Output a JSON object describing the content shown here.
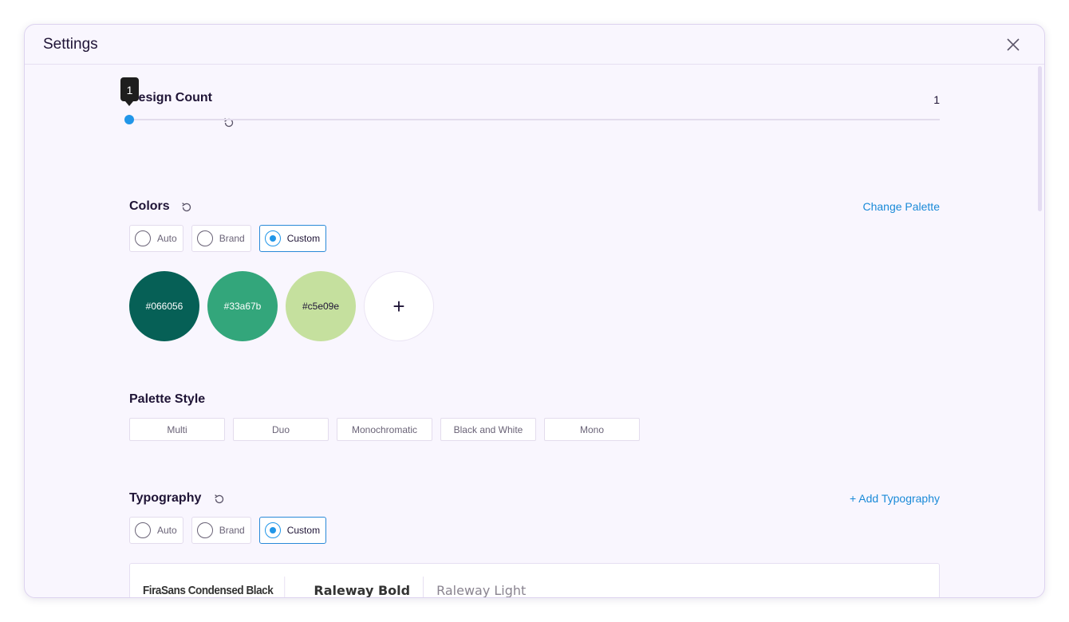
{
  "dialog": {
    "title": "Settings"
  },
  "design_count": {
    "label": "Design Count",
    "value": "1",
    "tooltip": "1",
    "level": 1
  },
  "colors": {
    "label": "Colors",
    "change_palette": "Change Palette",
    "options": [
      "Auto",
      "Brand",
      "Custom"
    ],
    "selected": "Custom",
    "swatches": [
      {
        "hex": "#066056",
        "text_color": "#ffffff"
      },
      {
        "hex": "#33a67b",
        "text_color": "#ffffff"
      },
      {
        "hex": "#c5e09e",
        "text_color": "#1f1436"
      }
    ],
    "add_label": "+"
  },
  "palette_style": {
    "label": "Palette Style",
    "options": [
      "Multi",
      "Duo",
      "Monochromatic",
      "Black and White",
      "Mono"
    ]
  },
  "typography": {
    "label": "Typography",
    "add_link": "+ Add Typography",
    "options": [
      "Auto",
      "Brand",
      "Custom"
    ],
    "selected": "Custom",
    "fonts": [
      "FiraSans Condensed Black",
      "Raleway Bold",
      "Raleway Light"
    ]
  },
  "colors_theme": {
    "accent": "#2196e8",
    "link": "#1a8ad8",
    "background": "#f9f6fe"
  }
}
